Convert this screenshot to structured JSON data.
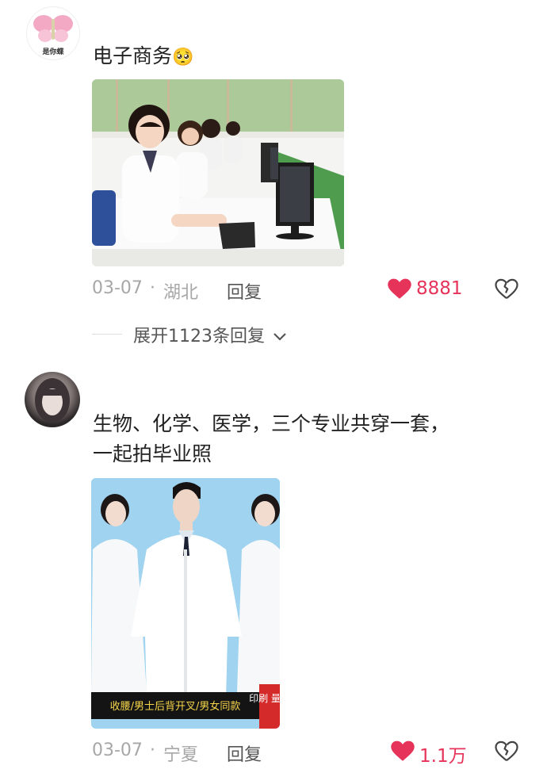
{
  "comments": [
    {
      "avatar_caption": "是你蝶",
      "text": "电子商务",
      "emoji": "🥺",
      "date": "03-07",
      "separator": "·",
      "location": "湖北",
      "reply_label": "回复",
      "likes": "8881",
      "expand_label": "展开1123条回复"
    },
    {
      "text_line1": "生物、化学、医学，三个专业共穿一套，",
      "text_line2": "一起拍毕业照",
      "image_banner": "收腰/男士后背开叉/男女同款",
      "image_corner": "印刷 量大",
      "date": "03-07",
      "separator": "·",
      "location": "宁夏",
      "reply_label": "回复",
      "likes": "1.1万"
    }
  ],
  "colors": {
    "like": "#e6335a",
    "meta": "#a7a7a7"
  },
  "icons": [
    "heart-icon",
    "broken-heart-icon",
    "chevron-down-icon"
  ]
}
